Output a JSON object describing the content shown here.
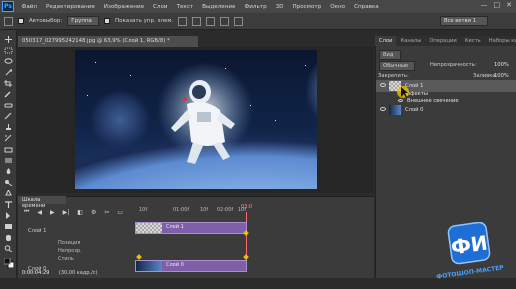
{
  "app": {
    "logo": "Ps"
  },
  "menu": [
    "Файл",
    "Редактирование",
    "Изображение",
    "Слои",
    "Текст",
    "Выделение",
    "Фильтр",
    "3D",
    "Просмотр",
    "Окно",
    "Справка"
  ],
  "window_controls": [
    "—",
    "□",
    "✕"
  ],
  "options": {
    "autoselect_label": "Автовыбор:",
    "autoselect_value": "Группа",
    "show_controls_label": "Показать упр. элем.",
    "workspace": "Все ветви 1"
  },
  "document": {
    "tab_title": "050317_027995242148.jpg @ 63,9% (Слой 1, RGB/8) *"
  },
  "timeline": {
    "tab_label": "Шкала времени",
    "ruler_ticks": [
      "10f",
      "01:00f",
      "10f",
      "02:00f",
      "10f",
      "03:0"
    ],
    "layer1_name": "Слой 1",
    "sub_rows": [
      "Позиция",
      "Непрозр.",
      "Стиль"
    ],
    "layer2_name": "Слой 0",
    "track1_label": "Слой 1",
    "track2_label": "Слой 0",
    "status_time": "0:00:04:29",
    "status_fps": "(30,00 кадр./с)"
  },
  "layers_panel": {
    "tabs": [
      "Слои",
      "Каналы",
      "Операции",
      "Кисть",
      "Наборы кистей"
    ],
    "filter_label": "Вид",
    "blend_mode": "Обычные",
    "opacity_label": "Непрозрачность:",
    "opacity_value": "100%",
    "lock_label": "Закрепить:",
    "fill_label": "Заливка:",
    "fill_value": "100%",
    "layers": [
      {
        "name": "Слой 1"
      },
      {
        "name": "Эффекты"
      },
      {
        "name": "Внешнее свечение"
      },
      {
        "name": "Слой 0"
      }
    ]
  },
  "watermark": {
    "text_top": "ФИ",
    "text_bottom": "ФОТОШОП-МАСТЕР"
  },
  "colors": {
    "accent_purple": "#7e5fa8",
    "ps_blue": "#3fa3ff",
    "playhead": "#ff6a6a"
  }
}
